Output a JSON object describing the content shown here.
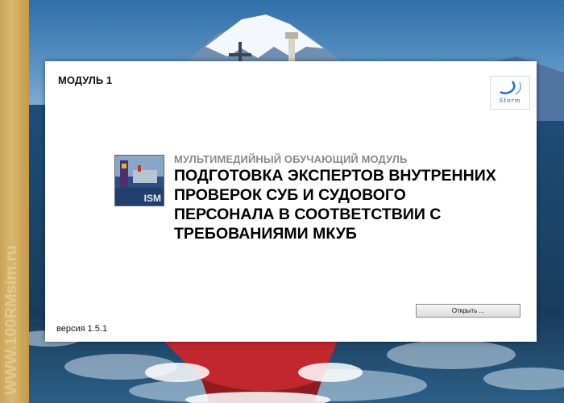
{
  "watermark": "WWW.100RMsim.ru",
  "dialog": {
    "module_label": "МОДУЛЬ 1",
    "logo_text": "Storm",
    "thumbnail_caption": "ISM",
    "subtitle": "МУЛЬТИМЕДИЙНЫЙ ОБУЧАЮЩИЙ МОДУЛЬ",
    "title_lines": [
      "ПОДГОТОВКА ЭКСПЕРТОВ ВНУТРЕННИХ",
      "ПРОВЕРОК СУБ И СУДОВОГО",
      "ПЕРСОНАЛА В СООТВЕТСТВИИ С",
      "ТРЕБОВАНИЯМИ МКУБ"
    ],
    "open_button": "Открыть ...",
    "version": "версия 1.5.1"
  },
  "colors": {
    "side_strip": "#d2b064",
    "sea": "#1a4468",
    "hull": "#c1272d",
    "subtitle": "#8a8a8a"
  }
}
